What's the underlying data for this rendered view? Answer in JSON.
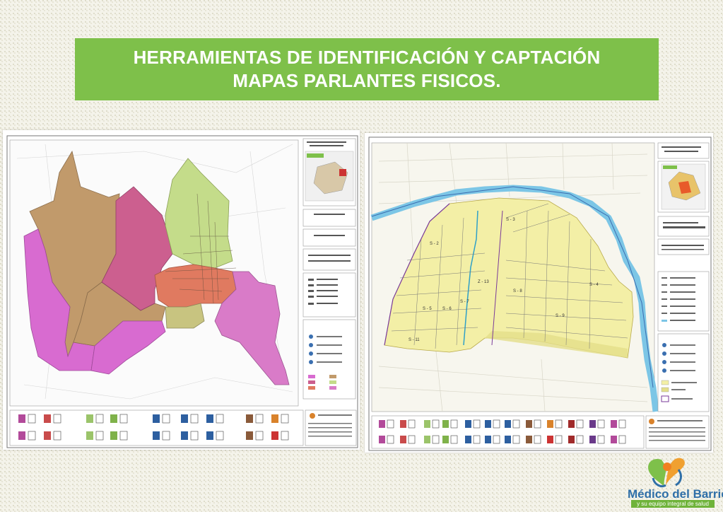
{
  "header": {
    "line1": "HERRAMIENTAS DE  IDENTIFICACIÓN Y CAPTACIÓN",
    "line2": "MAPAS PARLANTES FISICOS."
  },
  "left_map": {
    "zones": [
      {
        "name": "zona-tan-west",
        "color": "#c19a6b"
      },
      {
        "name": "zona-magenta-west",
        "color": "#d86bd0"
      },
      {
        "name": "zona-rose-center",
        "color": "#cc5f8f"
      },
      {
        "name": "zona-green-north",
        "color": "#c4dc8a"
      },
      {
        "name": "zona-salmon-center",
        "color": "#e07a60"
      },
      {
        "name": "zona-pink-east",
        "color": "#d97bc8"
      },
      {
        "name": "zona-olive-south",
        "color": "#c8c480"
      }
    ]
  },
  "right_map": {
    "labels": {
      "s2": "S - 2",
      "s3": "S - 3",
      "s5": "S - 5",
      "s6": "S - 6",
      "s7": "S - 7",
      "s8": "S - 8",
      "s9": "S - 9",
      "s11": "S - 11",
      "z13": "Z - 13",
      "s4": "S - 4"
    },
    "colors": {
      "area": "#f3efa6",
      "river": "#7cc6e6",
      "boundary": "#7a3a9a"
    }
  },
  "logo": {
    "name": "Médico del Barrio",
    "tagline": "y su equipo integral de salud"
  }
}
